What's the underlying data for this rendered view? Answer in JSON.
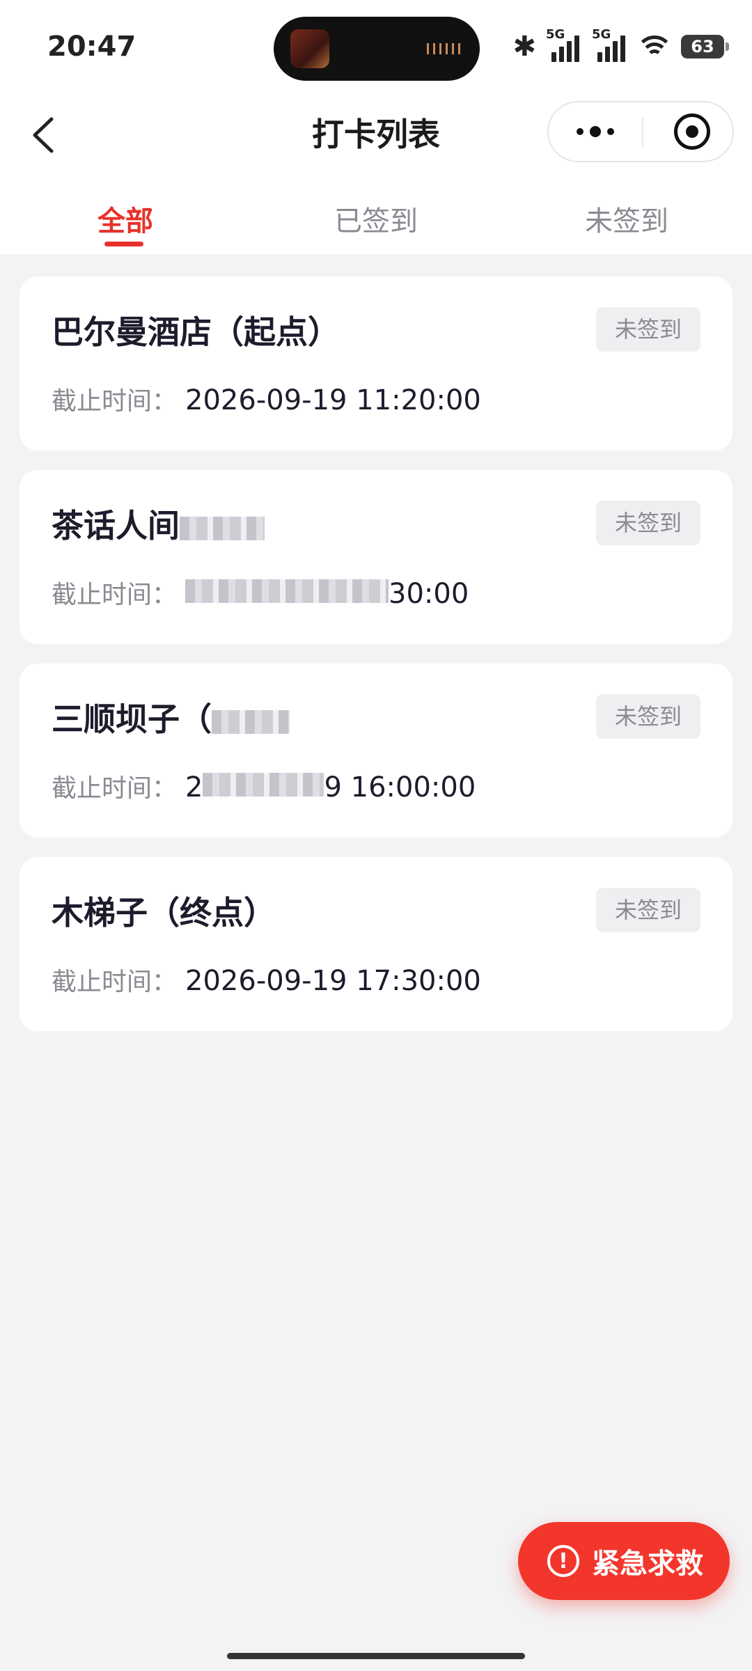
{
  "status_bar": {
    "time": "20:47",
    "network_1": "5G",
    "network_2": "5G",
    "battery": "63"
  },
  "nav": {
    "title": "打卡列表"
  },
  "tabs": [
    {
      "label": "全部",
      "active": true
    },
    {
      "label": "已签到",
      "active": false
    },
    {
      "label": "未签到",
      "active": false
    }
  ],
  "checkpoints": [
    {
      "name": "巴尔曼酒店（起点）",
      "status": "未签到",
      "deadline_label": "截止时间：",
      "deadline": "2026-09-19 11:20:00"
    },
    {
      "name": "茶话人间",
      "status": "未签到",
      "deadline_label": "截止时间：",
      "deadline": "30:00"
    },
    {
      "name": "三顺坝子（",
      "status": "未签到",
      "deadline_label": "截止时间：",
      "deadline_prefix": "2",
      "deadline": "9 16:00:00"
    },
    {
      "name": "木梯子（终点）",
      "status": "未签到",
      "deadline_label": "截止时间：",
      "deadline": "2026-09-19 17:30:00"
    }
  ],
  "sos_button": {
    "icon": "exclamation-circle-icon",
    "label": "紧急求救"
  },
  "colors": {
    "accent": "#e8312a",
    "sos": "#f2362c",
    "background": "#f3f3f4"
  }
}
